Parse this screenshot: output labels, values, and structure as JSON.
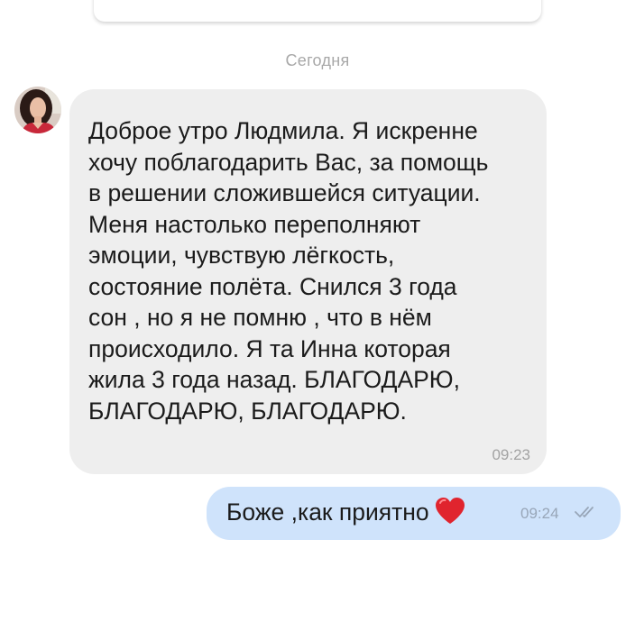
{
  "date_separator": "Сегодня",
  "messages": [
    {
      "direction": "incoming",
      "text": "Доброе утро Людмила. Я искренне\nхочу поблагодарить Вас, за помощь\nв решении сложившейся ситуации.\nМеня настолько переполняют\nэмоции, чувствую лёгкость,\nсостояние полёта.  Снился 3 года\nсон , но я не помню , что в нём\nпроисходило. Я та Инна которая\nжила 3 года назад. БЛАГОДАРЮ,\nБЛАГОДАРЮ, БЛАГОДАРЮ.",
      "time": "09:23",
      "bubble_color": "#eeeeee"
    },
    {
      "direction": "outgoing",
      "text": "Боже  ,как приятно",
      "emoji": "heart-emoji",
      "time": "09:24",
      "status_icon": "double-check-icon",
      "bubble_color": "#cfe3fb"
    }
  ]
}
